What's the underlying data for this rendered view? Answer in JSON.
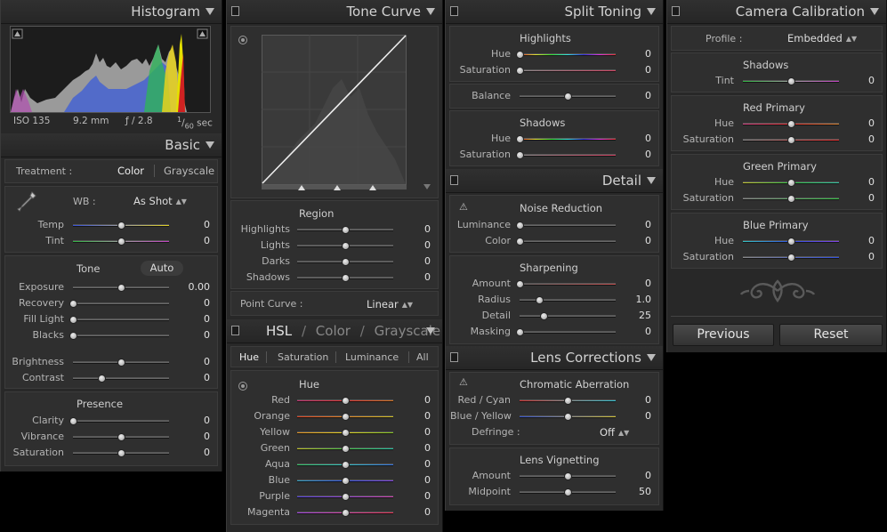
{
  "histogram": {
    "title": "Histogram",
    "iso": "ISO 135",
    "focal": "9.2 mm",
    "aperture": "ƒ / 2.8",
    "shutter_num": "1",
    "shutter_den": "60",
    "shutter_unit": "sec"
  },
  "basic": {
    "title": "Basic",
    "treatment_label": "Treatment :",
    "treatment_color": "Color",
    "treatment_gray": "Grayscale",
    "wb_label": "WB :",
    "wb_value": "As Shot",
    "wb_sliders": [
      {
        "label": "Temp",
        "value": "0",
        "pos": 0.5,
        "track": "temp"
      },
      {
        "label": "Tint",
        "value": "0",
        "pos": 0.5,
        "track": "tint"
      }
    ],
    "tone_title": "Tone",
    "auto": "Auto",
    "tone_sliders": [
      {
        "label": "Exposure",
        "value": "0.00",
        "pos": 0.5
      },
      {
        "label": "Recovery",
        "value": "0",
        "pos": 0.0
      },
      {
        "label": "Fill Light",
        "value": "0",
        "pos": 0.0
      },
      {
        "label": "Blacks",
        "value": "0",
        "pos": 0.0
      }
    ],
    "bc_sliders": [
      {
        "label": "Brightness",
        "value": "0",
        "pos": 0.5
      },
      {
        "label": "Contrast",
        "value": "0",
        "pos": 0.3
      }
    ],
    "presence_title": "Presence",
    "presence_sliders": [
      {
        "label": "Clarity",
        "value": "0",
        "pos": 0.0
      },
      {
        "label": "Vibrance",
        "value": "0",
        "pos": 0.5
      },
      {
        "label": "Saturation",
        "value": "0",
        "pos": 0.5
      }
    ]
  },
  "tone_curve": {
    "title": "Tone Curve",
    "region_title": "Region",
    "sliders": [
      {
        "label": "Highlights",
        "value": "0",
        "pos": 0.5
      },
      {
        "label": "Lights",
        "value": "0",
        "pos": 0.5
      },
      {
        "label": "Darks",
        "value": "0",
        "pos": 0.5
      },
      {
        "label": "Shadows",
        "value": "0",
        "pos": 0.5
      }
    ],
    "point_curve_label": "Point Curve :",
    "point_curve_value": "Linear"
  },
  "hsl": {
    "title_hsl": "HSL",
    "title_color": "Color",
    "title_gray": "Grayscale",
    "sep": "/",
    "tabs": [
      "Hue",
      "Saturation",
      "Luminance",
      "All"
    ],
    "section_title": "Hue",
    "sliders": [
      {
        "label": "Red",
        "value": "0",
        "pos": 0.5,
        "track": "red"
      },
      {
        "label": "Orange",
        "value": "0",
        "pos": 0.5,
        "track": "orange"
      },
      {
        "label": "Yellow",
        "value": "0",
        "pos": 0.5,
        "track": "yellow"
      },
      {
        "label": "Green",
        "value": "0",
        "pos": 0.5,
        "track": "green"
      },
      {
        "label": "Aqua",
        "value": "0",
        "pos": 0.5,
        "track": "aqua"
      },
      {
        "label": "Blue",
        "value": "0",
        "pos": 0.5,
        "track": "blue"
      },
      {
        "label": "Purple",
        "value": "0",
        "pos": 0.5,
        "track": "purple"
      },
      {
        "label": "Magenta",
        "value": "0",
        "pos": 0.5,
        "track": "magenta"
      }
    ]
  },
  "split": {
    "title": "Split Toning",
    "highlights_title": "Highlights",
    "highlights": [
      {
        "label": "Hue",
        "value": "0",
        "pos": 0.0,
        "track": "hue"
      },
      {
        "label": "Saturation",
        "value": "0",
        "pos": 0.0,
        "track": "sat"
      }
    ],
    "balance": {
      "label": "Balance",
      "value": "0",
      "pos": 0.5
    },
    "shadows_title": "Shadows",
    "shadows": [
      {
        "label": "Hue",
        "value": "0",
        "pos": 0.0,
        "track": "hue"
      },
      {
        "label": "Saturation",
        "value": "0",
        "pos": 0.0,
        "track": "sat"
      }
    ]
  },
  "detail": {
    "title": "Detail",
    "noise_title": "Noise Reduction",
    "noise": [
      {
        "label": "Luminance",
        "value": "0",
        "pos": 0.0
      },
      {
        "label": "Color",
        "value": "0",
        "pos": 0.0
      }
    ],
    "sharp_title": "Sharpening",
    "sharp": [
      {
        "label": "Amount",
        "value": "0",
        "pos": 0.0,
        "track": "amount"
      },
      {
        "label": "Radius",
        "value": "1.0",
        "pos": 0.2
      },
      {
        "label": "Detail",
        "value": "25",
        "pos": 0.25
      },
      {
        "label": "Masking",
        "value": "0",
        "pos": 0.0
      }
    ]
  },
  "lens": {
    "title": "Lens Corrections",
    "ca_title": "Chromatic Aberration",
    "ca": [
      {
        "label": "Red / Cyan",
        "value": "0",
        "pos": 0.5,
        "track": "redcyan"
      },
      {
        "label": "Blue / Yellow",
        "value": "0",
        "pos": 0.5,
        "track": "blueyellow"
      }
    ],
    "defringe_label": "Defringe :",
    "defringe_value": "Off",
    "vig_title": "Lens Vignetting",
    "vig": [
      {
        "label": "Amount",
        "value": "0",
        "pos": 0.5
      },
      {
        "label": "Midpoint",
        "value": "50",
        "pos": 0.5
      }
    ]
  },
  "calib": {
    "title": "Camera Calibration",
    "profile_label": "Profile :",
    "profile_value": "Embedded",
    "shadows_title": "Shadows",
    "shadows": [
      {
        "label": "Tint",
        "value": "0",
        "pos": 0.5,
        "track": "tint"
      }
    ],
    "red_title": "Red Primary",
    "red": [
      {
        "label": "Hue",
        "value": "0",
        "pos": 0.5,
        "track": "redhue"
      },
      {
        "label": "Saturation",
        "value": "0",
        "pos": 0.5,
        "track": "redsat"
      }
    ],
    "green_title": "Green Primary",
    "green": [
      {
        "label": "Hue",
        "value": "0",
        "pos": 0.5,
        "track": "greenhue"
      },
      {
        "label": "Saturation",
        "value": "0",
        "pos": 0.5,
        "track": "greensat"
      }
    ],
    "blue_title": "Blue Primary",
    "blue": [
      {
        "label": "Hue",
        "value": "0",
        "pos": 0.5,
        "track": "bluehue"
      },
      {
        "label": "Saturation",
        "value": "0",
        "pos": 0.5,
        "track": "bluesat"
      }
    ],
    "previous": "Previous",
    "reset": "Reset"
  }
}
